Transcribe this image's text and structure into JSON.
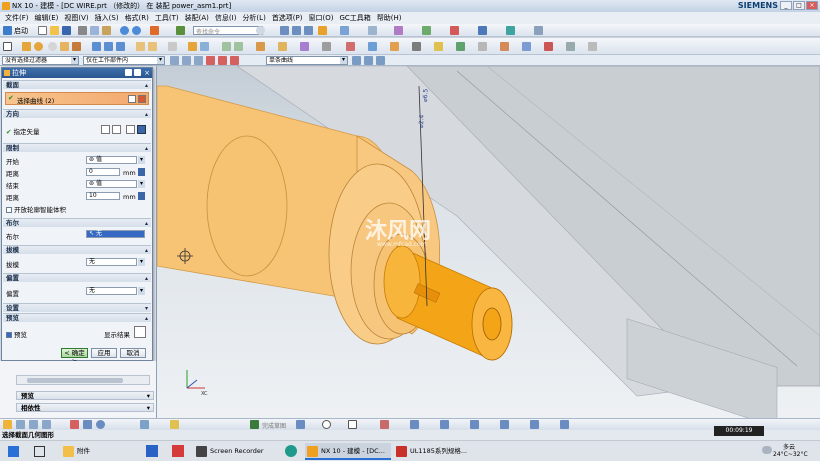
{
  "window": {
    "title": "NX 10 - 建模 - [DC WIRE.prt （修改的） 在 装配 power_asm1.prt]",
    "brand": "SIEMENS",
    "controls": [
      "_",
      "□",
      "×"
    ]
  },
  "menubar": [
    "文件(F)",
    "编辑(E)",
    "视图(V)",
    "插入(S)",
    "格式(R)",
    "工具(T)",
    "装配(A)",
    "信息(I)",
    "分析(L)",
    "首选项(P)",
    "窗口(O)",
    "GC工具箱",
    "帮助(H)"
  ],
  "toolbar": {
    "start_label": "启动",
    "search_placeholder": "查找命令"
  },
  "filterbar": {
    "type_filter": "没有选择过滤器",
    "scope": "仅在工作部件内",
    "curve_rule": "单条曲线"
  },
  "dialog": {
    "title": "拉伸",
    "close": "×",
    "sections": {
      "section": "截面",
      "direction": "方向",
      "limits": "限制",
      "boolean": "布尔",
      "draft": "拔模",
      "offset": "偏置",
      "settings": "设置",
      "preview": "预览"
    },
    "select_curve": "选择曲线 (2)",
    "specify_vector": "指定矢量",
    "start_label": "开始",
    "start_value": "值",
    "start_distance_label": "距离",
    "start_distance": "0",
    "end_label": "结束",
    "end_value": "值",
    "end_distance_label": "距离",
    "end_distance": "10",
    "unit": "mm",
    "open_profile": "开放轮廓智能体积",
    "boolean_label": "布尔",
    "boolean_value": "无",
    "draft_label": "拔模",
    "draft_value": "无",
    "offset_label": "偏置",
    "offset_value": "无",
    "preview_check": "预览",
    "show_result": "显示结果",
    "ok": "< 确定 >",
    "apply": "应用",
    "cancel": "取消"
  },
  "lower_panel": {
    "preview": "预览",
    "dependencies": "相依性"
  },
  "viewport": {
    "dim_label1": "⌀2.4",
    "dim_label2": "⌀6.5",
    "watermark": "沐风网",
    "watermark_url": "www.mfcad.com",
    "axis_label": "XC"
  },
  "statusbar": {
    "prompt": "选择截面几何图形"
  },
  "bottom_toolbar": {
    "mode": "完成草图"
  },
  "taskbar": {
    "items": [
      "附件",
      "Screen Recorder",
      "NX 10 - 建模 - [DC...",
      "UL1185系列规格..."
    ],
    "time_overlay": "00:09:19",
    "weather": "多云",
    "temperature": "24°C~32°C"
  }
}
